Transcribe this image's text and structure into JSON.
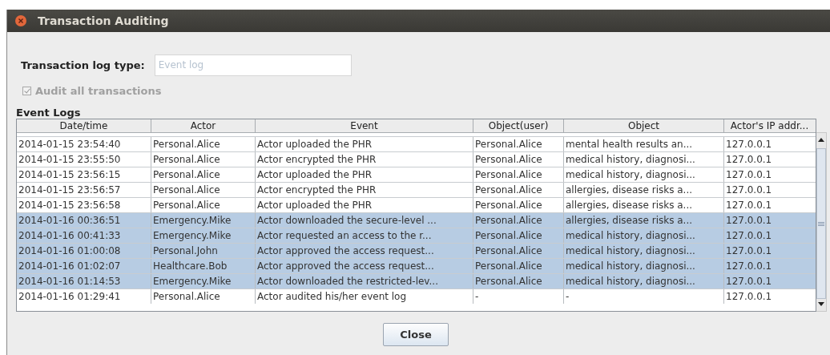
{
  "window": {
    "title": "Transaction Auditing"
  },
  "log_type": {
    "label": "Transaction log type:",
    "placeholder": "Event log"
  },
  "audit_all": {
    "label": "Audit all transactions",
    "checked": true,
    "disabled": true
  },
  "table": {
    "title": "Event Logs",
    "columns": [
      "Date/time",
      "Actor",
      "Event",
      "Object(user)",
      "Object",
      "Actor's IP addr..."
    ],
    "rows": [
      {
        "date": "2014-01-15 23:54:40",
        "actor": "Personal.Alice",
        "event": "Actor uploaded the PHR",
        "object_user": "Personal.Alice",
        "object": "mental health results an...",
        "ip": "127.0.0.1",
        "selected": false
      },
      {
        "date": "2014-01-15 23:55:50",
        "actor": "Personal.Alice",
        "event": "Actor encrypted the PHR",
        "object_user": "Personal.Alice",
        "object": "medical history, diagnosi...",
        "ip": "127.0.0.1",
        "selected": false
      },
      {
        "date": "2014-01-15 23:56:15",
        "actor": "Personal.Alice",
        "event": "Actor uploaded the PHR",
        "object_user": "Personal.Alice",
        "object": "medical history, diagnosi...",
        "ip": "127.0.0.1",
        "selected": false
      },
      {
        "date": "2014-01-15 23:56:57",
        "actor": "Personal.Alice",
        "event": "Actor encrypted the PHR",
        "object_user": "Personal.Alice",
        "object": "allergies, disease risks a...",
        "ip": "127.0.0.1",
        "selected": false
      },
      {
        "date": "2014-01-15 23:56:58",
        "actor": "Personal.Alice",
        "event": "Actor uploaded the PHR",
        "object_user": "Personal.Alice",
        "object": "allergies, disease risks a...",
        "ip": "127.0.0.1",
        "selected": false
      },
      {
        "date": "2014-01-16 00:36:51",
        "actor": "Emergency.Mike",
        "event": "Actor downloaded the secure-level ...",
        "object_user": "Personal.Alice",
        "object": "allergies, disease risks a...",
        "ip": "127.0.0.1",
        "selected": true
      },
      {
        "date": "2014-01-16 00:41:33",
        "actor": "Emergency.Mike",
        "event": "Actor requested an access to the r...",
        "object_user": "Personal.Alice",
        "object": "medical history, diagnosi...",
        "ip": "127.0.0.1",
        "selected": true
      },
      {
        "date": "2014-01-16 01:00:08",
        "actor": "Personal.John",
        "event": "Actor approved the access request...",
        "object_user": "Personal.Alice",
        "object": "medical history, diagnosi...",
        "ip": "127.0.0.1",
        "selected": true
      },
      {
        "date": "2014-01-16 01:02:07",
        "actor": "Healthcare.Bob",
        "event": "Actor approved the access request...",
        "object_user": "Personal.Alice",
        "object": "medical history, diagnosi...",
        "ip": "127.0.0.1",
        "selected": true
      },
      {
        "date": "2014-01-16 01:14:53",
        "actor": "Emergency.Mike",
        "event": "Actor downloaded the restricted-lev...",
        "object_user": "Personal.Alice",
        "object": "medical history, diagnosi...",
        "ip": "127.0.0.1",
        "selected": true
      },
      {
        "date": "2014-01-16 01:29:41",
        "actor": "Personal.Alice",
        "event": "Actor audited his/her event log",
        "object_user": "-",
        "object": "-",
        "ip": "127.0.0.1",
        "selected": false
      }
    ]
  },
  "buttons": [
    "Close"
  ]
}
